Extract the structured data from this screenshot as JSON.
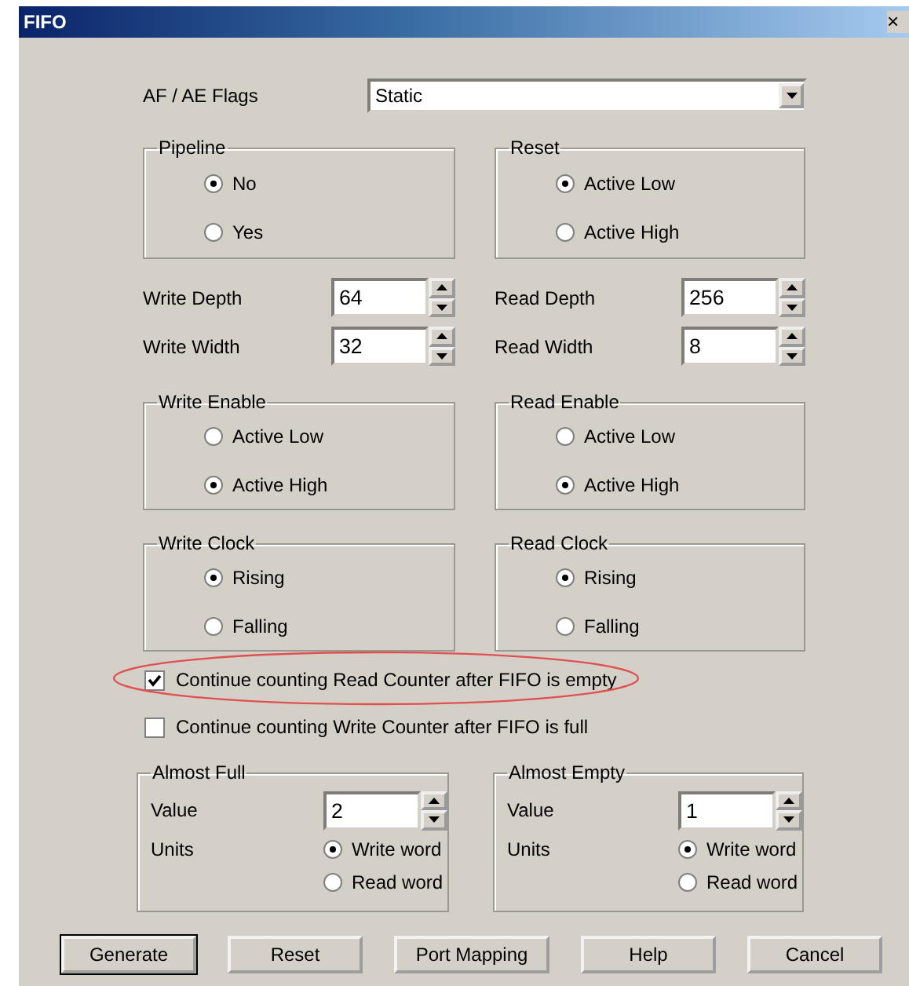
{
  "window": {
    "title": "FIFO",
    "close": "×"
  },
  "flags": {
    "label": "AF / AE Flags",
    "value": "Static"
  },
  "top_groups": [
    {
      "title": "Pipeline",
      "options": [
        {
          "label": "No",
          "selected": true
        },
        {
          "label": "Yes",
          "selected": false
        }
      ]
    },
    {
      "title": "Reset",
      "options": [
        {
          "label": "Active Low",
          "selected": true
        },
        {
          "label": "Active High",
          "selected": false
        }
      ]
    }
  ],
  "size_fields": [
    {
      "label": "Write Depth",
      "value": "64"
    },
    {
      "label": "Read Depth",
      "value": "256"
    },
    {
      "label": "Write Width",
      "value": "32"
    },
    {
      "label": "Read Width",
      "value": "8"
    }
  ],
  "signal_groups": [
    {
      "title": "Write Enable",
      "options": [
        {
          "label": "Active Low",
          "selected": false
        },
        {
          "label": "Active High",
          "selected": true
        }
      ]
    },
    {
      "title": "Read Enable",
      "options": [
        {
          "label": "Active Low",
          "selected": false
        },
        {
          "label": "Active High",
          "selected": true
        }
      ]
    },
    {
      "title": "Write Clock",
      "options": [
        {
          "label": "Rising",
          "selected": true
        },
        {
          "label": "Falling",
          "selected": false
        }
      ]
    },
    {
      "title": "Read Clock",
      "options": [
        {
          "label": "Rising",
          "selected": true
        },
        {
          "label": "Falling",
          "selected": false
        }
      ]
    }
  ],
  "checkboxes": [
    {
      "label": "Continue counting Read Counter after FIFO is empty",
      "checked": true,
      "highlighted": true
    },
    {
      "label": "Continue counting Write Counter after FIFO is full",
      "checked": false,
      "highlighted": false
    }
  ],
  "thresholds": [
    {
      "title": "Almost Full",
      "value_label": "Value",
      "value": "2",
      "units_label": "Units",
      "options": [
        {
          "label": "Write word",
          "selected": true
        },
        {
          "label": "Read word",
          "selected": false
        }
      ]
    },
    {
      "title": "Almost Empty",
      "value_label": "Value",
      "value": "1",
      "units_label": "Units",
      "options": [
        {
          "label": "Write word",
          "selected": true
        },
        {
          "label": "Read word",
          "selected": false
        }
      ]
    }
  ],
  "buttons": [
    {
      "label": "Generate",
      "default": true
    },
    {
      "label": "Reset",
      "default": false
    },
    {
      "label": "Port Mapping",
      "default": false
    },
    {
      "label": "Help",
      "default": false
    },
    {
      "label": "Cancel",
      "default": false
    }
  ]
}
